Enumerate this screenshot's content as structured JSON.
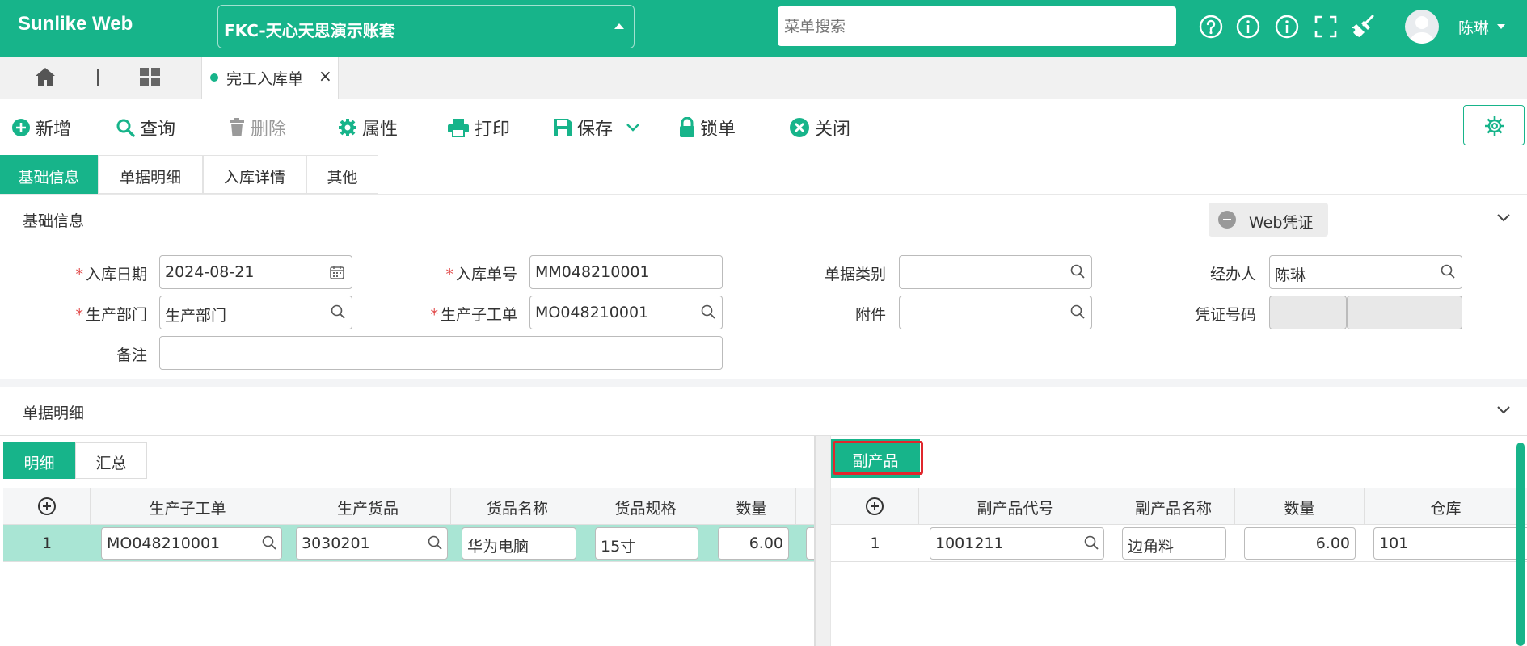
{
  "app": {
    "brand": "Sunlike Web",
    "account": "FKC-天心天思演示账套",
    "search_placeholder": "菜单搜索",
    "user": "陈琳"
  },
  "tabs": {
    "doc_tab": "完工入库单"
  },
  "toolbar": {
    "new": "新增",
    "query": "查询",
    "delete": "删除",
    "properties": "属性",
    "print": "打印",
    "save": "保存",
    "lock": "锁单",
    "close": "关闭"
  },
  "subtabs": [
    "基础信息",
    "单据明细",
    "入库详情",
    "其他"
  ],
  "basic": {
    "section_title": "基础信息",
    "web_voucher": "Web凭证",
    "fields": {
      "date_label": "入库日期",
      "date_value": "2024-08-21",
      "no_label": "入库单号",
      "no_value": "MM048210001",
      "category_label": "单据类别",
      "category_value": "",
      "handler_label": "经办人",
      "handler_value": "陈琳",
      "dept_label": "生产部门",
      "dept_value": "生产部门",
      "workorder_label": "生产子工单",
      "workorder_value": "MO048210001",
      "attach_label": "附件",
      "attach_value": "",
      "voucher_label": "凭证号码",
      "remark_label": "备注",
      "remark_value": ""
    }
  },
  "detail": {
    "section_title": "单据明细",
    "left_tabs": [
      "明细",
      "汇总"
    ],
    "left_columns": [
      "生产子工单",
      "生产货品",
      "货品名称",
      "货品规格",
      "数量"
    ],
    "left_rows": [
      {
        "no": "1",
        "workorder": "MO048210001",
        "item": "3030201",
        "name": "华为电脑",
        "spec": "15寸",
        "qty": "6.00"
      }
    ],
    "right_tab": "副产品",
    "right_columns": [
      "副产品代号",
      "副产品名称",
      "数量",
      "仓库"
    ],
    "right_rows": [
      {
        "no": "1",
        "code": "1001211",
        "name": "边角料",
        "qty": "6.00",
        "warehouse": "101"
      }
    ]
  },
  "colors": {
    "accent": "#17b48a",
    "highlight_border": "#e0272d",
    "required": "#e14b4b"
  }
}
